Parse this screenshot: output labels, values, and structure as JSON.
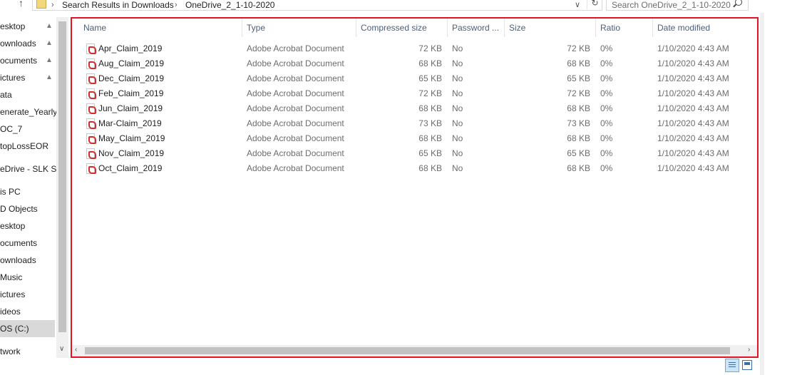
{
  "address_bar": {
    "breadcrumbs": [
      "Search Results in Downloads",
      "OneDrive_2_1-10-2020"
    ],
    "search_placeholder": "Search OneDrive_2_1-10-2020"
  },
  "nav_pane": {
    "items": [
      {
        "label": "esktop",
        "pinned": true
      },
      {
        "label": "ownloads",
        "pinned": true
      },
      {
        "label": "ocuments",
        "pinned": true
      },
      {
        "label": "ictures",
        "pinned": true
      },
      {
        "label": "ata",
        "pinned": false
      },
      {
        "label": "enerate_Yearly_",
        "pinned": false
      },
      {
        "label": "OC_7",
        "pinned": false
      },
      {
        "label": "topLossEOR",
        "pinned": false
      },
      {
        "label": "eDrive - SLK SC",
        "pinned": false
      },
      {
        "label": "is PC",
        "pinned": false
      },
      {
        "label": "D Objects",
        "pinned": false
      },
      {
        "label": "esktop",
        "pinned": false
      },
      {
        "label": "ocuments",
        "pinned": false
      },
      {
        "label": "ownloads",
        "pinned": false
      },
      {
        "label": "Music",
        "pinned": false
      },
      {
        "label": "ictures",
        "pinned": false
      },
      {
        "label": "ideos",
        "pinned": false
      },
      {
        "label": "OS (C:)",
        "pinned": false,
        "selected": true
      },
      {
        "label": "twork",
        "pinned": false
      }
    ]
  },
  "file_list": {
    "columns": [
      "Name",
      "Type",
      "Compressed size",
      "Password ...",
      "Size",
      "Ratio",
      "Date modified"
    ],
    "rows": [
      {
        "name": "Apr_Claim_2019",
        "type": "Adobe Acrobat Document",
        "compressed": "72 KB",
        "password": "No",
        "size": "72 KB",
        "ratio": "0%",
        "date": "1/10/2020 4:43 AM"
      },
      {
        "name": "Aug_Claim_2019",
        "type": "Adobe Acrobat Document",
        "compressed": "68 KB",
        "password": "No",
        "size": "68 KB",
        "ratio": "0%",
        "date": "1/10/2020 4:43 AM"
      },
      {
        "name": "Dec_Claim_2019",
        "type": "Adobe Acrobat Document",
        "compressed": "65 KB",
        "password": "No",
        "size": "65 KB",
        "ratio": "0%",
        "date": "1/10/2020 4:43 AM"
      },
      {
        "name": "Feb_Claim_2019",
        "type": "Adobe Acrobat Document",
        "compressed": "72 KB",
        "password": "No",
        "size": "72 KB",
        "ratio": "0%",
        "date": "1/10/2020 4:43 AM"
      },
      {
        "name": "Jun_Claim_2019",
        "type": "Adobe Acrobat Document",
        "compressed": "68 KB",
        "password": "No",
        "size": "68 KB",
        "ratio": "0%",
        "date": "1/10/2020 4:43 AM"
      },
      {
        "name": "Mar-Claim_2019",
        "type": "Adobe Acrobat Document",
        "compressed": "73 KB",
        "password": "No",
        "size": "73 KB",
        "ratio": "0%",
        "date": "1/10/2020 4:43 AM"
      },
      {
        "name": "May_Claim_2019",
        "type": "Adobe Acrobat Document",
        "compressed": "68 KB",
        "password": "No",
        "size": "68 KB",
        "ratio": "0%",
        "date": "1/10/2020 4:43 AM"
      },
      {
        "name": "Nov_Claim_2019",
        "type": "Adobe Acrobat Document",
        "compressed": "65 KB",
        "password": "No",
        "size": "65 KB",
        "ratio": "0%",
        "date": "1/10/2020 4:43 AM"
      },
      {
        "name": "Oct_Claim_2019",
        "type": "Adobe Acrobat Document",
        "compressed": "68 KB",
        "password": "No",
        "size": "68 KB",
        "ratio": "0%",
        "date": "1/10/2020 4:43 AM"
      }
    ]
  },
  "colors": {
    "highlight_border": "#e81123",
    "header_text": "#4c607a",
    "pdf_icon": "#d42c2c"
  }
}
